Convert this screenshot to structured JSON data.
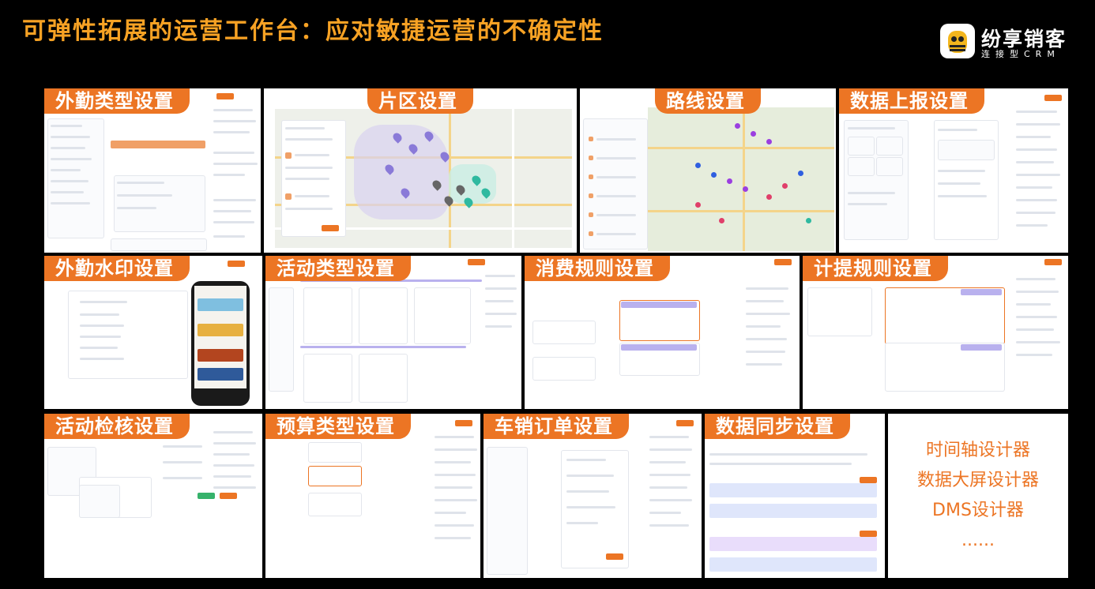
{
  "page": {
    "title": "可弹性拓展的运营工作台：应对敏捷运营的不确定性"
  },
  "logo": {
    "name": "纷享销客",
    "subtitle": "连接型CRM",
    "icon": "bee-icon"
  },
  "tiles": [
    {
      "id": "field-type",
      "label": "外勤类型设置"
    },
    {
      "id": "area",
      "label": "片区设置"
    },
    {
      "id": "route",
      "label": "路线设置"
    },
    {
      "id": "data-report",
      "label": "数据上报设置"
    },
    {
      "id": "watermark",
      "label": "外勤水印设置"
    },
    {
      "id": "activity-type",
      "label": "活动类型设置"
    },
    {
      "id": "consume-rule",
      "label": "消费规则设置"
    },
    {
      "id": "accrual-rule",
      "label": "计提规则设置"
    },
    {
      "id": "activity-check",
      "label": "活动检核设置"
    },
    {
      "id": "budget-type",
      "label": "预算类型设置"
    },
    {
      "id": "car-order",
      "label": "车销订单设置"
    },
    {
      "id": "data-sync",
      "label": "数据同步设置"
    }
  ],
  "more_list": {
    "items": [
      "时间轴设计器",
      "数据大屏设计器",
      "DMS设计器"
    ],
    "ellipsis": "......"
  },
  "colors": {
    "accent": "#ec7524",
    "title": "#f7a224",
    "background": "#000000"
  }
}
